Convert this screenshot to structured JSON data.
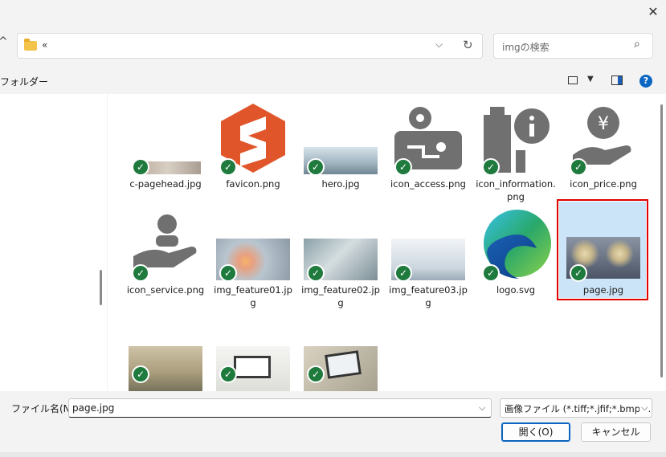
{
  "window": {
    "close_icon": "close-icon"
  },
  "address_bar": {
    "breadcrumb": "«",
    "folder_icon": "folder-icon"
  },
  "search": {
    "placeholder": "imgの検索"
  },
  "toolbar": {
    "new_folder_label": "フォルダー"
  },
  "files": [
    {
      "name": "c-pagehead.jpg",
      "checked": true
    },
    {
      "name": "favicon.png",
      "checked": true
    },
    {
      "name": "hero.jpg",
      "checked": true
    },
    {
      "name": "icon_access.png",
      "checked": true
    },
    {
      "name": "icon_information.png",
      "checked": true
    },
    {
      "name": "icon_price.png",
      "checked": true
    },
    {
      "name": "icon_service.png",
      "checked": true
    },
    {
      "name": "img_feature01.jpg",
      "checked": true
    },
    {
      "name": "img_feature02.jpg",
      "checked": true
    },
    {
      "name": "img_feature03.jpg",
      "checked": true
    },
    {
      "name": "logo.svg",
      "checked": true
    },
    {
      "name": "page.jpg",
      "checked": true,
      "selected": true
    },
    {
      "name": "",
      "checked": true
    },
    {
      "name": "",
      "checked": true
    },
    {
      "name": "",
      "checked": true
    }
  ],
  "footer": {
    "filename_label": "ファイル名(N):",
    "filename_value": "page.jpg",
    "filetype_value": "画像ファイル (*.tiff;*.jfif;*.bmp;*.p",
    "open_label": "開く(O)",
    "cancel_label": "キャンセル"
  },
  "colors": {
    "accent": "#0a64bf",
    "check": "#1f7a3d",
    "selection_outline": "#e00000",
    "selection_fill": "#cce4f7"
  }
}
